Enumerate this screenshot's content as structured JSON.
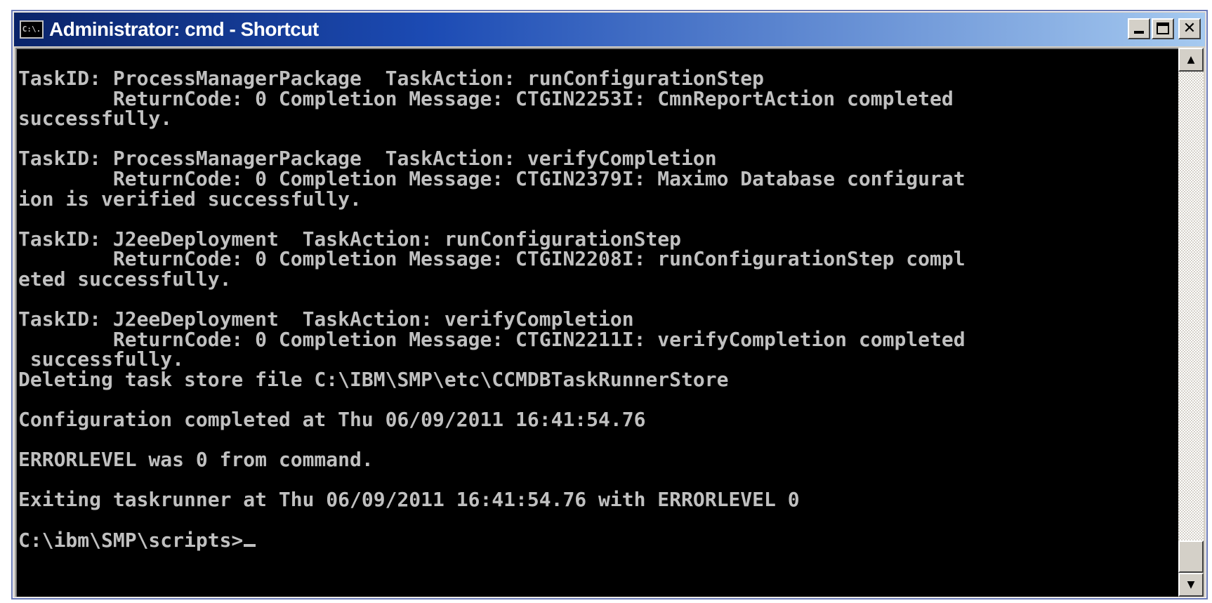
{
  "window": {
    "title": "Administrator: cmd - Shortcut",
    "icon_label": "C:\\."
  },
  "titlebar_buttons": {
    "minimize": "minimize",
    "maximize": "maximize",
    "close_glyph": "✕"
  },
  "console": {
    "lines": [
      "TaskID: ProcessManagerPackage  TaskAction: runConfigurationStep",
      "        ReturnCode: 0 Completion Message: CTGIN2253I: CmnReportAction completed",
      "successfully.",
      "",
      "TaskID: ProcessManagerPackage  TaskAction: verifyCompletion",
      "        ReturnCode: 0 Completion Message: CTGIN2379I: Maximo Database configurat",
      "ion is verified successfully.",
      "",
      "TaskID: J2eeDeployment  TaskAction: runConfigurationStep",
      "        ReturnCode: 0 Completion Message: CTGIN2208I: runConfigurationStep compl",
      "eted successfully.",
      "",
      "TaskID: J2eeDeployment  TaskAction: verifyCompletion",
      "        ReturnCode: 0 Completion Message: CTGIN2211I: verifyCompletion completed",
      " successfully.",
      "Deleting task store file C:\\IBM\\SMP\\etc\\CCMDBTaskRunnerStore",
      "",
      "Configuration completed at Thu 06/09/2011 16:41:54.76",
      "",
      "ERRORLEVEL was 0 from command.",
      "",
      "Exiting taskrunner at Thu 06/09/2011 16:41:54.76 with ERRORLEVEL 0",
      ""
    ],
    "prompt": "C:\\ibm\\SMP\\scripts>"
  },
  "scrollbar": {
    "up_arrow": "▲",
    "down_arrow": "▼",
    "position_fraction": 1.0
  },
  "colors": {
    "console_bg": "#000000",
    "console_text": "#c0c0c0",
    "title_active_start": "#0a246a",
    "title_active_end": "#a6caf0"
  }
}
